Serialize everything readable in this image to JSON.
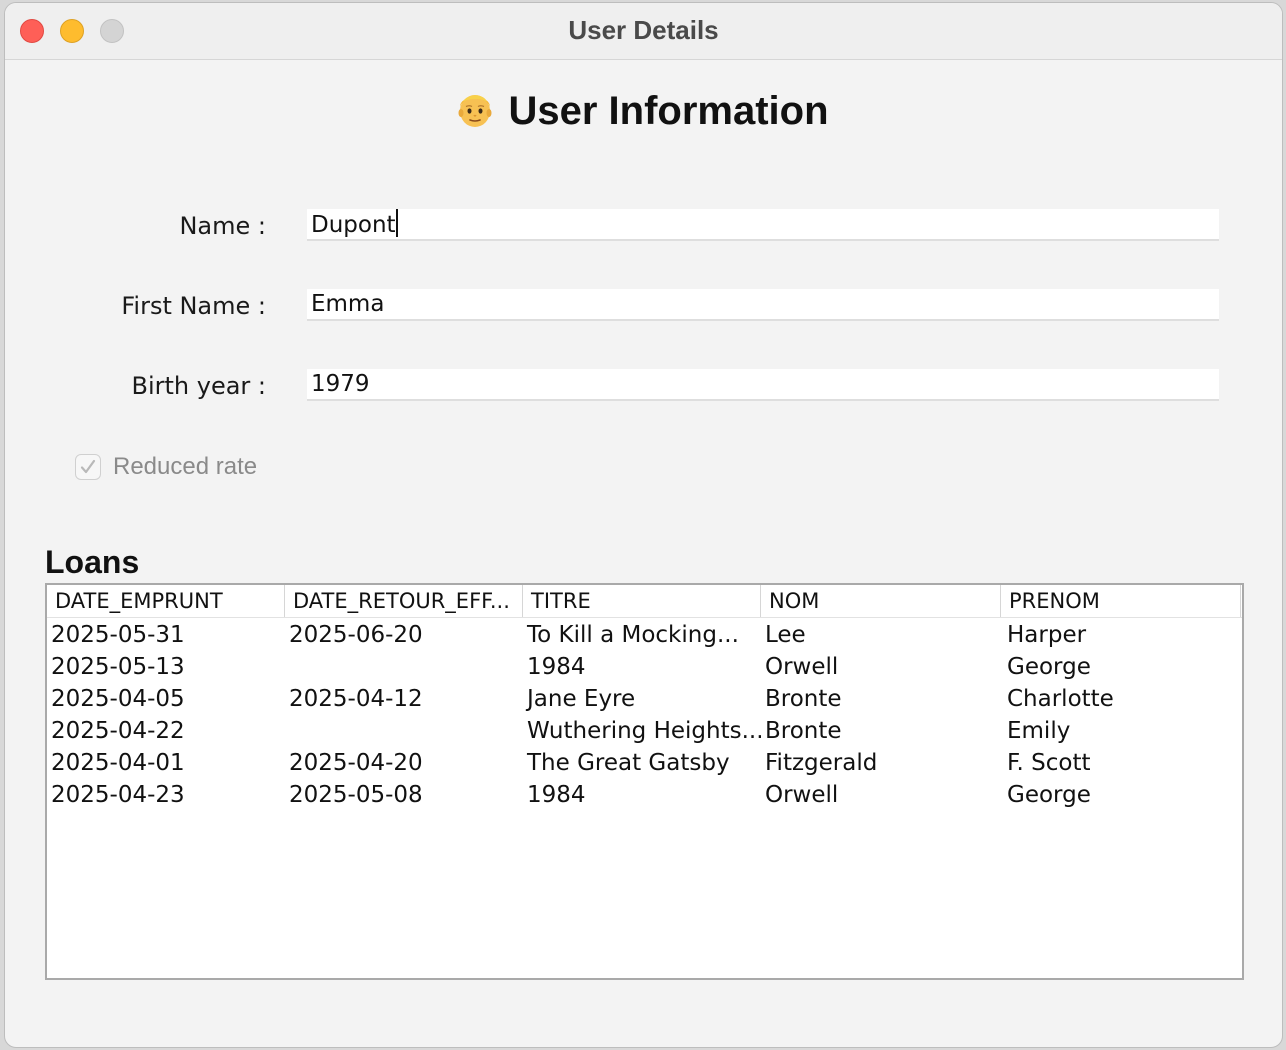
{
  "window": {
    "title": "User Details"
  },
  "header": {
    "icon": "man-face-emoji-icon",
    "title": "User Information"
  },
  "form": {
    "name_label": "Name :",
    "name_value": "Dupont",
    "first_name_label": "First Name :",
    "first_name_value": "Emma",
    "birth_year_label": "Birth year :",
    "birth_year_value": "1979",
    "reduced_rate_label": "Reduced rate",
    "reduced_rate_checked": true
  },
  "loans": {
    "title": "Loans",
    "columns": [
      "DATE_EMPRUNT",
      "DATE_RETOUR_EFF...",
      "TITRE",
      "NOM",
      "PRENOM"
    ],
    "rows": [
      [
        "2025-05-31",
        "2025-06-20",
        "To Kill a Mocking...",
        "Lee",
        "Harper"
      ],
      [
        "2025-05-13",
        "",
        "1984",
        "Orwell",
        "George"
      ],
      [
        "2025-04-05",
        "2025-04-12",
        "Jane Eyre",
        "Bronte",
        "Charlotte"
      ],
      [
        "2025-04-22",
        "",
        "Wuthering Heights...",
        "Bronte",
        "Emily"
      ],
      [
        "2025-04-01",
        "2025-04-20",
        "The Great Gatsby",
        "Fitzgerald",
        "F. Scott"
      ],
      [
        "2025-04-23",
        "2025-05-08",
        "1984",
        "Orwell",
        "George"
      ]
    ]
  },
  "colors": {
    "window_bg": "#f3f3f3",
    "close": "#fe5f57",
    "minimize": "#febc2e",
    "maximize_disabled": "#d4d4d4",
    "muted_text": "#8a8a8a"
  }
}
